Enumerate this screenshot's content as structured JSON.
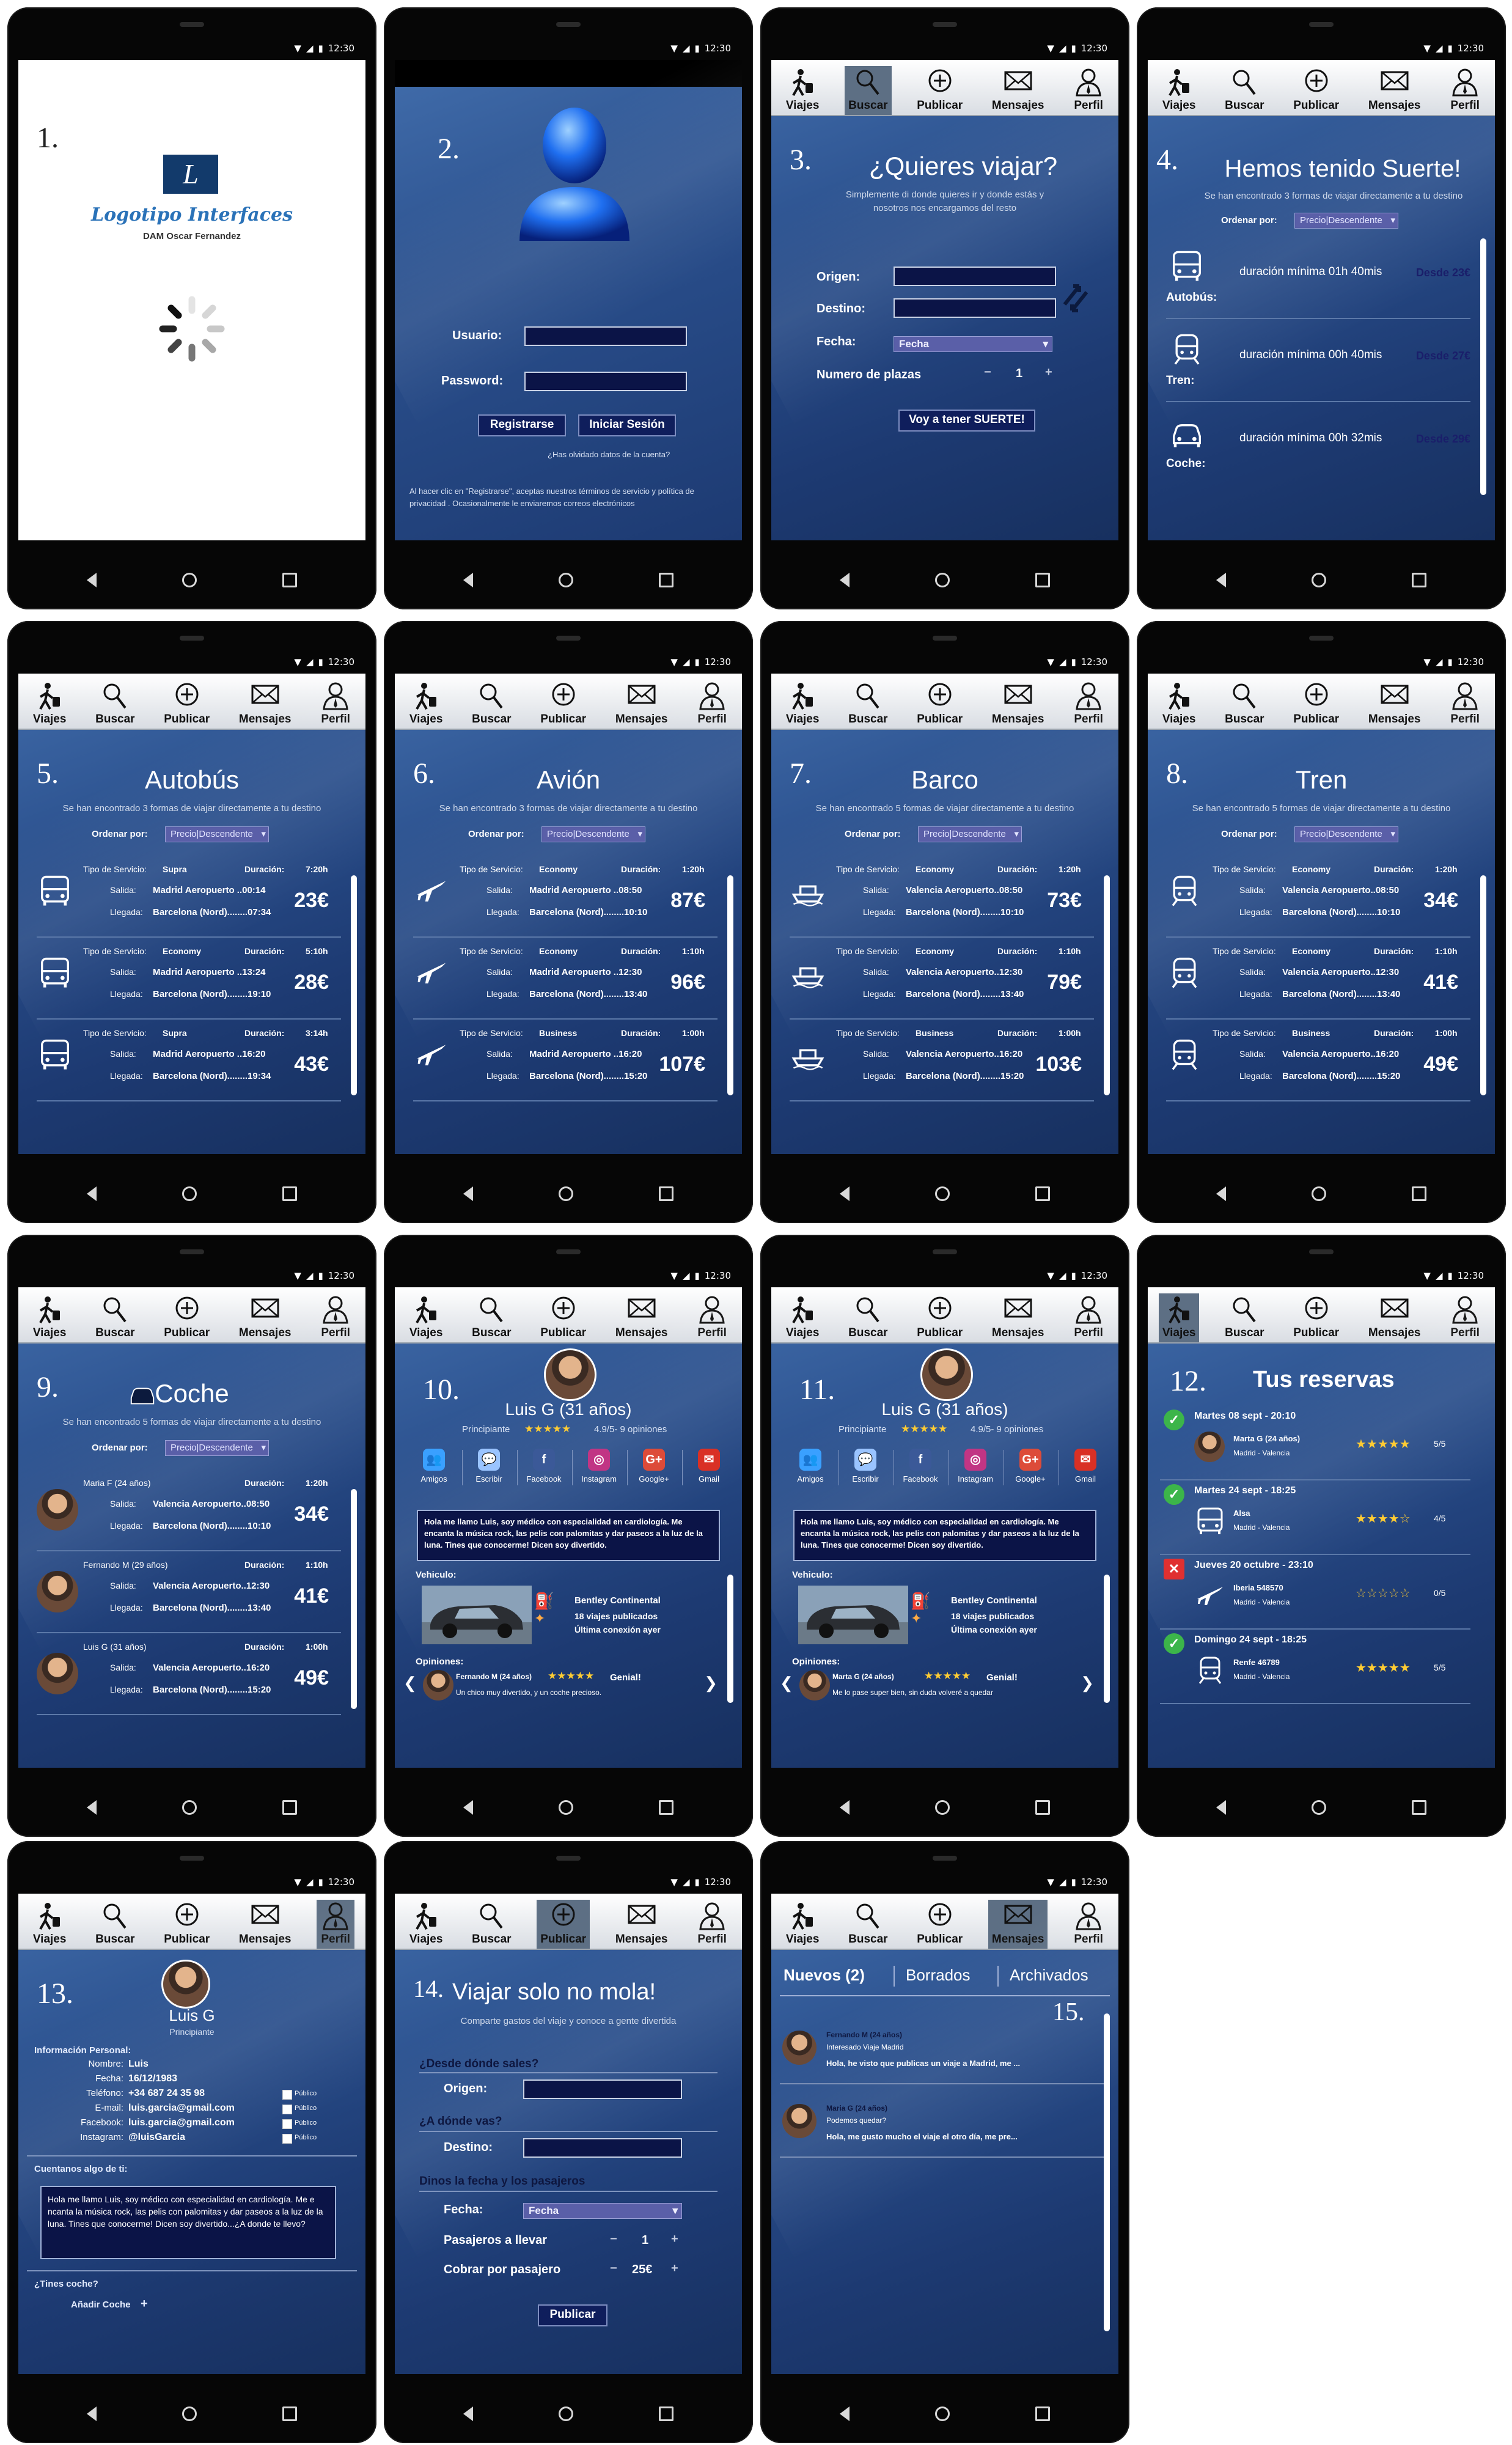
{
  "status": {
    "time": "12:30"
  },
  "tabs": [
    "Viajes",
    "Buscar",
    "Publicar",
    "Mensajes",
    "Perfil"
  ],
  "s1": {
    "num": "1.",
    "logo": "Logotipo Interfaces",
    "author": "DAM Oscar Fernandez"
  },
  "s2": {
    "num": "2.",
    "user_label": "Usuario:",
    "pass_label": "Password:",
    "register": "Registrarse",
    "login": "Iniciar Sesión",
    "forgot": "¿Has olvidado datos de la cuenta?",
    "terms": "Al hacer clic en \"Registrarse\", aceptas nuestros términos de servicio y política de privacidad . Ocasionalmente le enviaremos correos electrónicos"
  },
  "s3": {
    "num": "3.",
    "title": "¿Quieres viajar?",
    "subtitle": "Simplemente di donde quieres ir y donde estás y nosotros nos encargamos del resto",
    "origin": "Origen:",
    "dest": "Destino:",
    "date": "Fecha:",
    "date_value": "Fecha",
    "seats": "Numero de plazas",
    "seats_value": "1",
    "minus": "−",
    "plus": "+",
    "cta": "Voy a tener SUERTE!"
  },
  "s4": {
    "num": "4.",
    "title": "Hemos tenido Suerte!",
    "subtitle": "Se han encontrado 3 formas de viajar directamente a tu destino",
    "order": "Ordenar por:",
    "order_value": "Precio|Descendente",
    "items": [
      {
        "type": "Autobús:",
        "dur": "duración mínima 01h 40mis",
        "from": "Desde 23€"
      },
      {
        "type": "Tren:",
        "dur": "duración mínima 00h 40mis",
        "from": "Desde 27€"
      },
      {
        "type": "Coche:",
        "dur": "duración mínima 00h 32mis",
        "from": "Desde 29€"
      }
    ]
  },
  "s5": {
    "num": "5.",
    "title": "Autobús",
    "subtitle": "Se han encontrado 3 formas de viajar directamente a tu destino",
    "order": "Ordenar por:",
    "order_value": "Precio|Descendente",
    "items": [
      {
        "service": "Supra",
        "duration": "7:20h",
        "out": "Madrid Aeropuerto ..00:14",
        "arr": "Barcelona (Nord)........07:34",
        "price": "23€"
      },
      {
        "service": "Economy",
        "duration": "5:10h",
        "out": "Madrid Aeropuerto ..13:24",
        "arr": "Barcelona (Nord)........19:10",
        "price": "28€"
      },
      {
        "service": "Supra",
        "duration": "3:14h",
        "out": "Madrid Aeropuerto ..16:20",
        "arr": "Barcelona (Nord)........19:34",
        "price": "43€"
      }
    ]
  },
  "s6": {
    "num": "6.",
    "title": "Avión",
    "subtitle": "Se han encontrado 3 formas de viajar directamente a tu destino",
    "order": "Ordenar por:",
    "order_value": "Precio|Descendente",
    "items": [
      {
        "service": "Economy",
        "duration": "1:20h",
        "out": "Madrid Aeropuerto ..08:50",
        "arr": "Barcelona (Nord)........10:10",
        "price": "87€"
      },
      {
        "service": "Economy",
        "duration": "1:10h",
        "out": "Madrid Aeropuerto ..12:30",
        "arr": "Barcelona (Nord)........13:40",
        "price": "96€"
      },
      {
        "service": "Business",
        "duration": "1:00h",
        "out": "Madrid Aeropuerto ..16:20",
        "arr": "Barcelona (Nord)........15:20",
        "price": "107€"
      }
    ]
  },
  "s7": {
    "num": "7.",
    "title": "Barco",
    "subtitle": "Se han encontrado 5 formas de viajar directamente a tu destino",
    "order": "Ordenar por:",
    "order_value": "Precio|Descendente",
    "items": [
      {
        "service": "Economy",
        "duration": "1:20h",
        "out": "Valencia Aeropuerto..08:50",
        "arr": "Barcelona (Nord)........10:10",
        "price": "73€"
      },
      {
        "service": "Economy",
        "duration": "1:10h",
        "out": "Valencia Aeropuerto..12:30",
        "arr": "Barcelona (Nord)........13:40",
        "price": "79€"
      },
      {
        "service": "Business",
        "duration": "1:00h",
        "out": "Valencia Aeropuerto..16:20",
        "arr": "Barcelona (Nord)........15:20",
        "price": "103€"
      }
    ]
  },
  "s8": {
    "num": "8.",
    "title": "Tren",
    "subtitle": "Se han encontrado 5 formas de viajar directamente a tu destino",
    "order": "Ordenar por:",
    "order_value": "Precio|Descendente",
    "items": [
      {
        "service": "Economy",
        "duration": "1:20h",
        "out": "Valencia Aeropuerto..08:50",
        "arr": "Barcelona (Nord)........10:10",
        "price": "34€"
      },
      {
        "service": "Economy",
        "duration": "1:10h",
        "out": "Valencia Aeropuerto..12:30",
        "arr": "Barcelona (Nord)........13:40",
        "price": "41€"
      },
      {
        "service": "Business",
        "duration": "1:00h",
        "out": "Valencia Aeropuerto..16:20",
        "arr": "Barcelona (Nord)........15:20",
        "price": "49€"
      }
    ]
  },
  "s9": {
    "num": "9.",
    "title": "Coche",
    "subtitle": "Se han encontrado 5 formas de viajar directamente a tu destino",
    "order": "Ordenar por:",
    "order_value": "Precio|Descendente",
    "items": [
      {
        "driver": "Maria F (24 años)",
        "duration": "1:20h",
        "out": "Valencia Aeropuerto..08:50",
        "arr": "Barcelona (Nord)........10:10",
        "price": "34€"
      },
      {
        "driver": "Fernando M (29 años)",
        "duration": "1:10h",
        "out": "Valencia Aeropuerto..12:30",
        "arr": "Barcelona (Nord)........13:40",
        "price": "41€"
      },
      {
        "driver": "Luis G (31 años)",
        "duration": "1:00h",
        "out": "Valencia Aeropuerto..16:20",
        "arr": "Barcelona (Nord)........15:20",
        "price": "49€"
      }
    ]
  },
  "common": {
    "service_label": "Tipo de Servicio:",
    "duration_label": "Duración:",
    "out_label": "Salida:",
    "arr_label": "Llegada:"
  },
  "s10": {
    "num": "10.",
    "name": "Luis G (31 años)",
    "level": "Principiante",
    "rating": "4.9/5- 9 opiniones",
    "socials": [
      "Amigos",
      "Escribir",
      "Facebook",
      "Instagram",
      "Google+",
      "Gmail"
    ],
    "bio": "Hola me llamo Luis, soy médico con especialidad en cardiología. Me encanta la música rock, las pelis con palomitas y dar paseos a la luz de la luna. Tines que conocerme! Dicen soy divertido.",
    "vehicle_label": "Vehiculo:",
    "car": "Bentley Continental",
    "trips": "18 viajes publicados",
    "last": "Última conexión ayer",
    "opinions_label": "Opiniones:",
    "op_author": "Fernando M (24 años)",
    "op_tag": "Genial!",
    "op_text": "Un chico muy divertido, y un coche precioso."
  },
  "s11": {
    "num": "11.",
    "name": "Luis G (31 años)",
    "level": "Principiante",
    "rating": "4.9/5- 9 opiniones",
    "socials": [
      "Amigos",
      "Escribir",
      "Facebook",
      "Instagram",
      "Google+",
      "Gmail"
    ],
    "bio": "Hola me llamo Luis, soy médico con especialidad en cardiología. Me encanta la música rock, las pelis con palomitas y dar paseos a la luz de la luna. Tines que conocerme! Dicen soy divertido.",
    "vehicle_label": "Vehiculo:",
    "car": "Bentley Continental",
    "trips": "18 viajes publicados",
    "last": "Última conexión ayer",
    "opinions_label": "Opiniones:",
    "op_author": "Marta G (24 años)",
    "op_tag": "Genial!",
    "op_text": "Me lo pase super bien, sin duda volveré a quedar"
  },
  "s12": {
    "num": "12.",
    "title": "Tus reservas",
    "items": [
      {
        "date": "Martes 08 sept - 20:10",
        "who": "Marta G (24 años)",
        "route": "Madrid - Valencia",
        "score": "5/5",
        "status": "ok",
        "stars": 5
      },
      {
        "date": "Martes 24 sept - 18:25",
        "who": "Alsa",
        "route": "Madrid - Valencia",
        "score": "4/5",
        "status": "ok",
        "stars": 4
      },
      {
        "date": "Jueves 20 octubre - 23:10",
        "who": "Iberia 548570",
        "route": "Madrid - Valencia",
        "score": "0/5",
        "status": "cancel",
        "stars": 0
      },
      {
        "date": "Domingo 24 sept - 18:25",
        "who": "Renfe 46789",
        "route": "Madrid - Valencia",
        "score": "5/5",
        "status": "ok",
        "stars": 5
      }
    ]
  },
  "s13": {
    "num": "13.",
    "name": "Luis G",
    "level": "Principiante",
    "info_title": "Información Personal:",
    "fields": [
      {
        "k": "Nombre:",
        "v": "Luis"
      },
      {
        "k": "Fecha:",
        "v": "16/12/1983"
      },
      {
        "k": "Teléfono:",
        "v": "+34 687 24 35 98"
      },
      {
        "k": "E-mail:",
        "v": "luis.garcia@gmail.com"
      },
      {
        "k": "Facebook:",
        "v": "luis.garcia@gmail.com"
      },
      {
        "k": "Instagram:",
        "v": "@luisGarcia"
      }
    ],
    "public": "Público",
    "about_title": "Cuentanos algo de ti:",
    "about": "Hola me llamo Luis, soy médico con especialidad en cardiología. Me e ncanta la música rock, las pelis con palomitas y dar paseos a la luz de la luna. Tines que conocerme! Dicen soy divertido...¿A donde te llevo?",
    "car_q": "¿Tines coche?",
    "add_car": "Añadir Coche",
    "add_plus": "+"
  },
  "s14": {
    "num": "14.",
    "title": "Viajar solo no mola!",
    "subtitle": "Comparte gastos del viaje y conoce a gente divertida",
    "q1": "¿Desde dónde sales?",
    "origin": "Origen:",
    "q2": "¿A dónde vas?",
    "dest": "Destino:",
    "q3": "Dinos la fecha y los pasajeros",
    "date": "Fecha:",
    "date_value": "Fecha",
    "pass": "Pasajeros a llevar",
    "pass_value": "1",
    "cost": "Cobrar por pasajero",
    "cost_value": "25€",
    "minus": "−",
    "plus": "+",
    "cta": "Publicar"
  },
  "s15": {
    "num": "15.",
    "tabs": [
      "Nuevos (2)",
      "Borrados",
      "Archivados"
    ],
    "msgs": [
      {
        "from": "Fernando M (24 años)",
        "subject": "Interesado Viaje Madrid",
        "preview": "Hola, he visto que publicas un viaje a Madrid, me ..."
      },
      {
        "from": "Maria G (24 años)",
        "subject": "Podemos quedar?",
        "preview": "Hola, me gusto mucho el viaje el otro día, me pre..."
      }
    ]
  }
}
